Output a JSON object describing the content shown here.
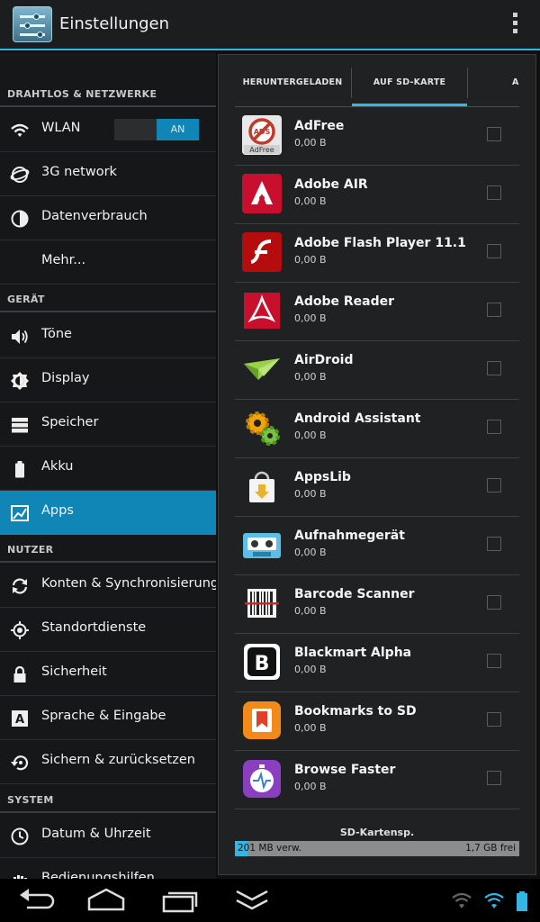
{
  "actionbar": {
    "title": "Einstellungen"
  },
  "sections": {
    "wireless": "DRAHTLOS & NETZWERKE",
    "device": "GERÄT",
    "user": "NUTZER",
    "system": "SYSTEM"
  },
  "settings": {
    "wlan": "WLAN",
    "wlan_toggle": "AN",
    "network": "3G network",
    "data_usage": "Datenverbrauch",
    "more": "Mehr...",
    "sounds": "Töne",
    "display": "Display",
    "storage": "Speicher",
    "battery": "Akku",
    "apps": "Apps",
    "accounts": "Konten & Synchronisierung",
    "location": "Standortdienste",
    "security": "Sicherheit",
    "language": "Sprache & Eingabe",
    "backup": "Sichern & zurücksetzen",
    "datetime": "Datum & Uhrzeit",
    "accessibility": "Bedienungshilfen"
  },
  "tabs": {
    "downloaded": "HERUNTERGELADEN",
    "sdcard": "AUF SD-KARTE",
    "running": "A"
  },
  "apps": [
    {
      "name": "AdFree",
      "size": "0,00 B",
      "icon": "adfree-icon"
    },
    {
      "name": "Adobe AIR",
      "size": "0,00 B",
      "icon": "adobe-air-icon"
    },
    {
      "name": "Adobe Flash Player 11.1",
      "size": "0,00 B",
      "icon": "flash-icon"
    },
    {
      "name": "Adobe Reader",
      "size": "0,00 B",
      "icon": "adobe-reader-icon"
    },
    {
      "name": "AirDroid",
      "size": "0,00 B",
      "icon": "airdroid-icon"
    },
    {
      "name": "Android Assistant",
      "size": "0,00 B",
      "icon": "gears-icon"
    },
    {
      "name": "AppsLib",
      "size": "0,00 B",
      "icon": "appslib-icon"
    },
    {
      "name": "Aufnahmegerät",
      "size": "0,00 B",
      "icon": "cassette-icon"
    },
    {
      "name": "Barcode Scanner",
      "size": "0,00 B",
      "icon": "barcode-icon"
    },
    {
      "name": "Blackmart Alpha",
      "size": "0,00 B",
      "icon": "blackmart-icon"
    },
    {
      "name": "Bookmarks to SD",
      "size": "0,00 B",
      "icon": "bookmark-icon"
    },
    {
      "name": "Browse Faster",
      "size": "0,00 B",
      "icon": "stopwatch-icon"
    }
  ],
  "storage": {
    "label": "SD-Kartensp.",
    "used": "201 MB verw.",
    "free": "1,7 GB frei"
  },
  "colors": {
    "accent": "#33b5e5",
    "selected": "#0f86b6"
  }
}
